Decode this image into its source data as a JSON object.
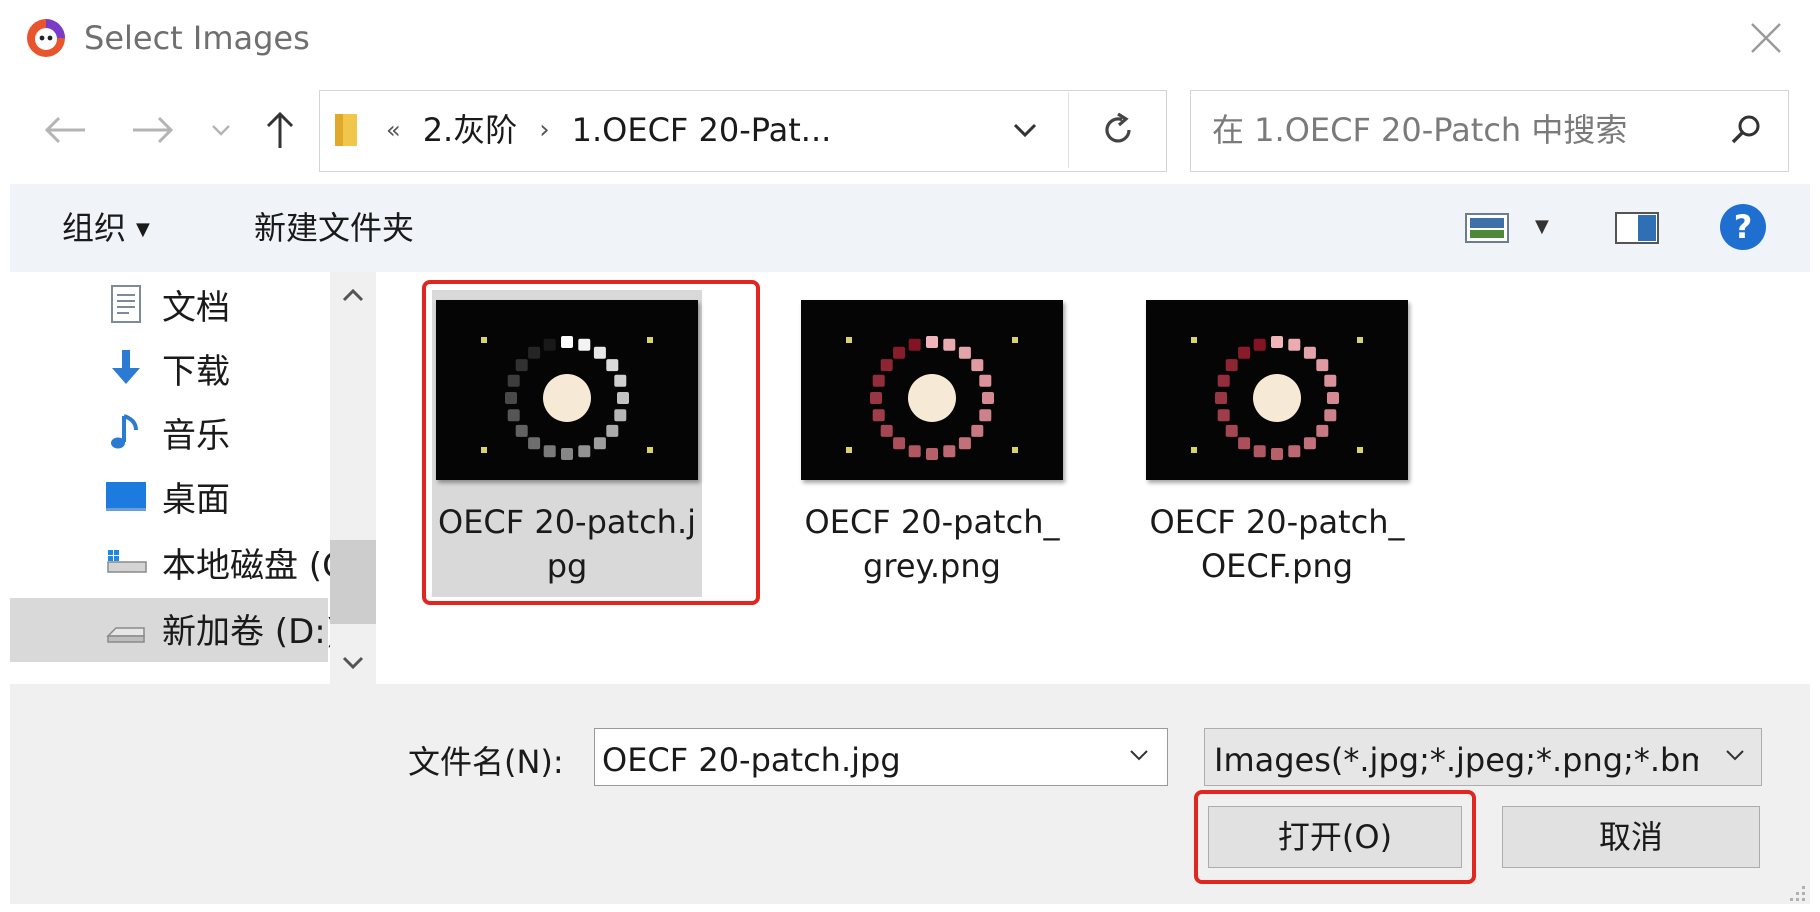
{
  "window": {
    "title": "Select Images",
    "app_icon": "app-logo-icon",
    "close_icon": "close-icon"
  },
  "address_bar": {
    "back_icon": "back-arrow-icon",
    "forward_icon": "forward-arrow-icon",
    "recent_icon": "chevron-down-icon",
    "up_icon": "up-arrow-icon",
    "overflow": "«",
    "crumbs": [
      "2.灰阶",
      "1.OECF 20-Pat..."
    ],
    "dropdown_icon": "chevron-down-icon",
    "refresh_icon": "refresh-icon"
  },
  "search": {
    "placeholder": "在 1.OECF 20-Patch 中搜索",
    "icon": "search-icon"
  },
  "toolbar": {
    "organize_label": "组织",
    "organize_caret": "▼",
    "new_folder_label": "新建文件夹",
    "view_caret": "▼",
    "view_icon": "view-options-icon",
    "pane_icon": "preview-pane-icon",
    "help_label": "?"
  },
  "nav_pane": {
    "items": [
      {
        "label": "文档",
        "icon": "documents-icon"
      },
      {
        "label": "下载",
        "icon": "downloads-icon"
      },
      {
        "label": "音乐",
        "icon": "music-icon"
      },
      {
        "label": "桌面",
        "icon": "desktop-icon"
      },
      {
        "label": "本地磁盘 (C:)",
        "icon": "local-disk-icon"
      },
      {
        "label": "新加卷 (D:)",
        "icon": "drive-icon",
        "selected": true
      }
    ]
  },
  "files": [
    {
      "name": "OECF 20-patch.jpg",
      "selected": true,
      "thumbnail": "white"
    },
    {
      "name": "OECF 20-patch_grey.png",
      "selected": false,
      "thumbnail": "pink"
    },
    {
      "name": "OECF 20-patch_OECF.png",
      "selected": false,
      "thumbnail": "pink"
    }
  ],
  "footer": {
    "filename_label": "文件名(N):",
    "filename_value": "OECF 20-patch.jpg",
    "filetype_value": "Images(*.jpg;*.jpeg;*.png;*.bmp)",
    "open_label": "打开(O)",
    "cancel_label": "取消"
  },
  "colors": {
    "highlight_frame": "#e0261f",
    "toolbar_bg": "#f0f3f8",
    "help_blue": "#1f6fd1"
  }
}
